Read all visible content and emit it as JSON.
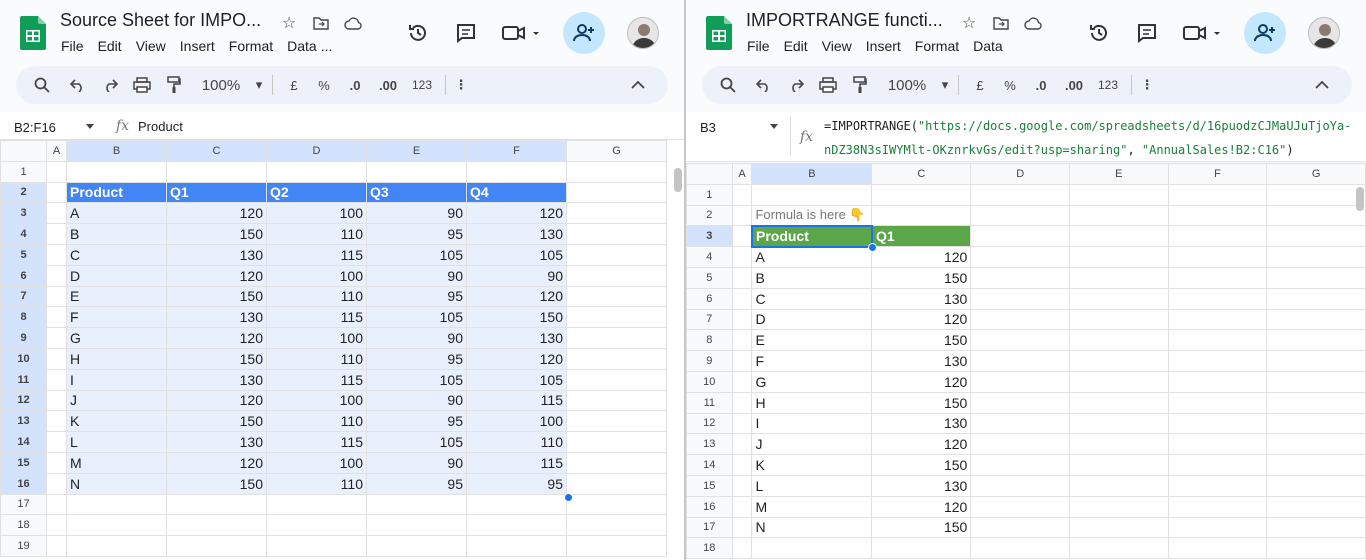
{
  "left": {
    "title": "Source Sheet for IMPO...",
    "menu": [
      "File",
      "Edit",
      "View",
      "Insert",
      "Format",
      "Data",
      "..."
    ],
    "toolbar": {
      "zoom": "100%",
      "currency": "£",
      "percent": "%",
      "dec_decrease": ".0",
      "dec_increase": ".00",
      "format_num": "123"
    },
    "name_box": "B2:F16",
    "formula": "Product",
    "columns": [
      "A",
      "B",
      "C",
      "D",
      "E",
      "F",
      "G"
    ],
    "header_row": [
      "Product",
      "Q1",
      "Q2",
      "Q3",
      "Q4"
    ],
    "rows": [
      [
        "A",
        "120",
        "100",
        "90",
        "120"
      ],
      [
        "B",
        "150",
        "110",
        "95",
        "130"
      ],
      [
        "C",
        "130",
        "115",
        "105",
        "105"
      ],
      [
        "D",
        "120",
        "100",
        "90",
        "90"
      ],
      [
        "E",
        "150",
        "110",
        "95",
        "120"
      ],
      [
        "F",
        "130",
        "115",
        "105",
        "150"
      ],
      [
        "G",
        "120",
        "100",
        "90",
        "130"
      ],
      [
        "H",
        "150",
        "110",
        "95",
        "120"
      ],
      [
        "I",
        "130",
        "115",
        "105",
        "105"
      ],
      [
        "J",
        "120",
        "100",
        "90",
        "115"
      ],
      [
        "K",
        "150",
        "110",
        "95",
        "100"
      ],
      [
        "L",
        "130",
        "115",
        "105",
        "110"
      ],
      [
        "M",
        "120",
        "100",
        "90",
        "115"
      ],
      [
        "N",
        "150",
        "110",
        "95",
        "95"
      ]
    ],
    "row_numbers": [
      "1",
      "2",
      "3",
      "4",
      "5",
      "6",
      "7",
      "8",
      "9",
      "10",
      "11",
      "12",
      "13",
      "14",
      "15",
      "16",
      "17",
      "18",
      "19"
    ]
  },
  "right": {
    "title": "IMPORTRANGE functi...",
    "menu": [
      "File",
      "Edit",
      "View",
      "Insert",
      "Format",
      "Data"
    ],
    "toolbar": {
      "zoom": "100%",
      "currency": "£",
      "percent": "%",
      "dec_decrease": ".0",
      "dec_increase": ".00",
      "format_num": "123"
    },
    "name_box": "B3",
    "formula_prefix": "=IMPORTRANGE(",
    "formula_url_1": "\"https://docs.google.com/spreadsheets/d/16puodzCJMaUJuTjoYa-",
    "formula_url_2": "nDZ38N3sIWYMlt-OKznrkvGs/edit?usp=sharing\"",
    "formula_sep": ", ",
    "formula_range": "\"AnnualSales!B2:C16\"",
    "formula_suffix": ")",
    "columns": [
      "A",
      "B",
      "C",
      "D",
      "E",
      "F",
      "G"
    ],
    "note": "Formula is here 👇",
    "header_row": [
      "Product",
      "Q1"
    ],
    "rows": [
      [
        "A",
        "120"
      ],
      [
        "B",
        "150"
      ],
      [
        "C",
        "130"
      ],
      [
        "D",
        "120"
      ],
      [
        "E",
        "150"
      ],
      [
        "F",
        "130"
      ],
      [
        "G",
        "120"
      ],
      [
        "H",
        "150"
      ],
      [
        "I",
        "130"
      ],
      [
        "J",
        "120"
      ],
      [
        "K",
        "150"
      ],
      [
        "L",
        "130"
      ],
      [
        "M",
        "120"
      ],
      [
        "N",
        "150"
      ]
    ],
    "row_numbers": [
      "1",
      "2",
      "3",
      "4",
      "5",
      "6",
      "7",
      "8",
      "9",
      "10",
      "11",
      "12",
      "13",
      "14",
      "15",
      "16",
      "17",
      "18"
    ]
  },
  "colors": {
    "accent_blue": "#4285f4",
    "accent_green": "#5aa648",
    "selection": "#d3e3fd",
    "share_bg": "#c2e7ff"
  }
}
